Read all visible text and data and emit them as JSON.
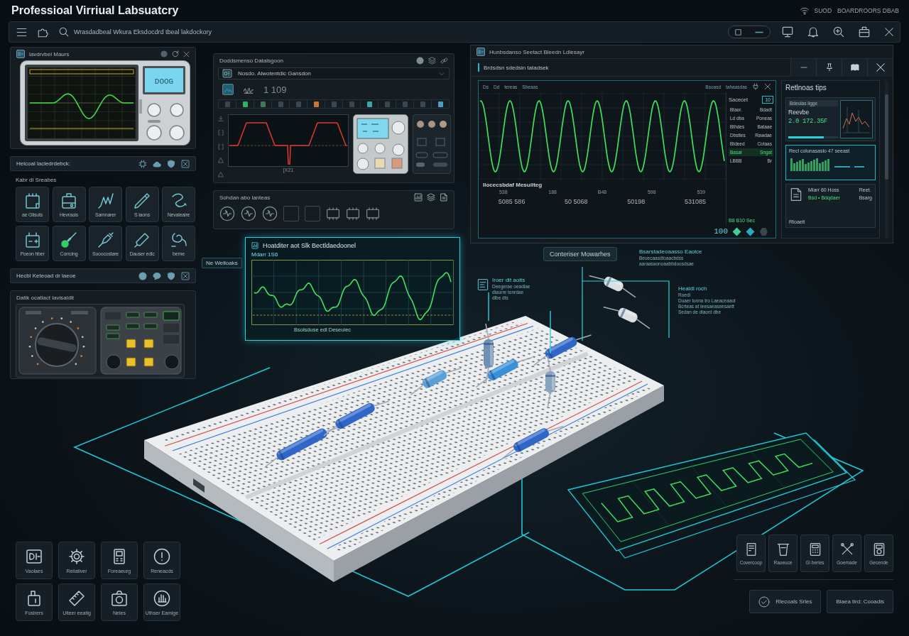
{
  "header": {
    "title": "Professioal Virriual Labsuatcry",
    "status": [
      "SUOD",
      "BOARDROORS DBAB"
    ]
  },
  "toolbar": {
    "breadcrumb": "Wrasdadbeal Wkura Eksdocdrd tbeal lakdockory"
  },
  "oscilloscope_window": {
    "title": "lavdrvbel Maurs",
    "display": "DOOG"
  },
  "library_bar": {
    "title": "Helcoal lacledrdebck:"
  },
  "components": {
    "heading": "Kabr di Sreabes",
    "items": [
      {
        "label": "ae Glisuts"
      },
      {
        "label": "Hevraois"
      },
      {
        "label": "Samnarer"
      },
      {
        "label": "S laons"
      },
      {
        "label": "Nevaleaire"
      },
      {
        "label": "Poeon hber"
      },
      {
        "label": "Corrcing"
      },
      {
        "label": "Sooocostare"
      },
      {
        "label": "Dauser edic"
      },
      {
        "label": "berne"
      }
    ]
  },
  "keyboard_bar": {
    "title": "Hecbl Keteoad dr laeoe"
  },
  "multimeter_panel": {
    "title": "Datik ocatlact lavisaldlt"
  },
  "signal_panel": {
    "title": "Doddsmenso Datalsgoon",
    "dropdown": "Nosdo. Alwotentdic Gansdon",
    "reading": "1 109",
    "slots": [
      {
        "color": "#3a4650"
      },
      {
        "color": "#2fb35a"
      },
      {
        "color": "#3c7a58"
      },
      {
        "color": "#3a4650"
      },
      {
        "color": "#3a4650"
      },
      {
        "color": "#c8782e"
      },
      {
        "color": "#3a4650"
      },
      {
        "color": "#3a4650"
      },
      {
        "color": "#3aa7a8"
      },
      {
        "color": "#3a4650"
      },
      {
        "color": "#3a4650"
      },
      {
        "color": "#3a4650"
      },
      {
        "color": "#4a9fc0"
      }
    ],
    "axis_label": "[X21"
  },
  "shapes_panel": {
    "title": "Sohdan abo lanteas"
  },
  "analyzer_window": {
    "title": "Hunbsdanso Seetact Bleedn Ldlesayr",
    "subtitle": "Brdsdsn sdedsin tatadsek",
    "toolbar_labels": [
      "Ds",
      "Dd",
      "tereas",
      "Sbeaas"
    ],
    "tool_labels": [
      "Bsoasd",
      "tahaasdas"
    ],
    "plot_label": "Ilocecsbdaf Mesuilteg",
    "ticks": [
      "538",
      "188",
      "B48",
      "598",
      "539"
    ],
    "scale": [
      "5085 586",
      "50 5068",
      "50198",
      "531085"
    ],
    "list": {
      "title": "Sacecet",
      "badge": "10",
      "rows": [
        {
          "name": "Btaor.",
          "value": "Bdadt",
          "selected": false
        },
        {
          "name": "Ld dba",
          "value": "Poneas",
          "selected": false
        },
        {
          "name": "Bthdes",
          "value": "Bataae",
          "selected": false
        },
        {
          "name": "Dbstles",
          "value": "Rawdae",
          "selected": false
        },
        {
          "name": "Btdeed",
          "value": "Cotaas",
          "selected": false
        },
        {
          "name": "Basat",
          "value": "Sngat",
          "selected": true
        },
        {
          "name": "LBBB",
          "value": "Br",
          "selected": false
        }
      ],
      "footer": "B8 B10 Sec"
    },
    "readout": "100"
  },
  "tips": {
    "title": "Retlnoas tips",
    "metric": {
      "caption": "Bdeulas ligge",
      "label": "Reevbe",
      "value": "2.0 172.35F",
      "level": 0.72
    },
    "chart_card": {
      "text": "Recl colunasaslo 47 seeast"
    },
    "note_card": {
      "title": "Mlarr 60 Hoss",
      "detail": "Bsd • Bdqdaer",
      "side": "Reet.",
      "side_detail": "Bsarg",
      "footer": "Rtoaeit"
    }
  },
  "scene": {
    "hologram": {
      "title": "Hoatditer aot Slk Bectldaedoonel",
      "reading": "Mdarr 1S6",
      "footer": "Bsolsduse edl Deseuiec"
    },
    "tag": "Ne Welloaks",
    "connector_tag": "Conteriser Mowarhes",
    "notes": [
      {
        "title": "Iroer dit aoits",
        "lines": [
          "Deegerae oeadlae",
          "dlaurre tonrdae",
          "dlbe dts"
        ]
      },
      {
        "title": "Bsarstadeoaasso Eaolce",
        "lines": [
          "Beuecaasdtoaacbdss",
          "aaraasaonoaabbdoosdsae"
        ]
      },
      {
        "title": "Healdl roch",
        "lines": [
          "Roedl",
          "Duaer lonna tro Laeaceaaut",
          "Bcrteas at Ieesaeaseesaett",
          "Sedan de dlaont dbe"
        ]
      }
    ]
  },
  "tools": {
    "items": [
      {
        "label": "Vaolaes"
      },
      {
        "label": "Reiiativer"
      },
      {
        "label": "Foreaeurg"
      },
      {
        "label": "Reneacds"
      },
      {
        "label": "Foslrers"
      },
      {
        "label": "Uiteer eeatig"
      },
      {
        "label": "Neles"
      },
      {
        "label": "Uthser Eamige"
      }
    ]
  },
  "quick_tools": {
    "items": [
      {
        "label": "Covercoop"
      },
      {
        "label": "Raoeuce"
      },
      {
        "label": "Gi beries"
      },
      {
        "label": "Goemade"
      },
      {
        "label": "Gecende"
      }
    ]
  },
  "actions": [
    {
      "label": "Rlecoals Srles"
    },
    {
      "label": "Blaea tird: Cooadis"
    }
  ]
}
